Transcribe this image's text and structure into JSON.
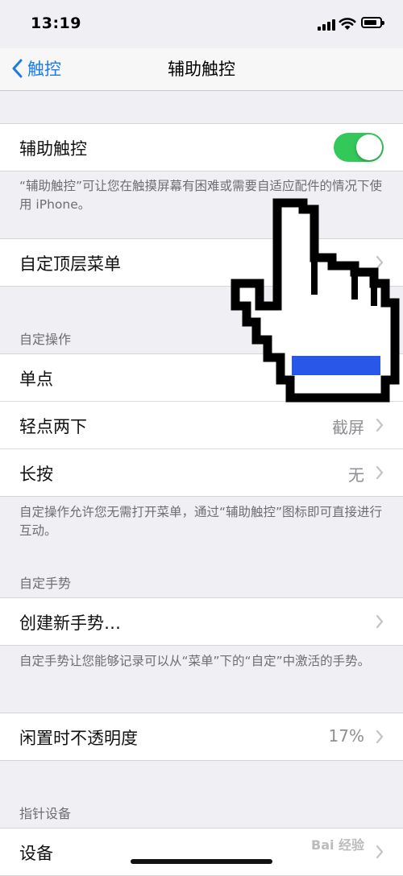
{
  "status_bar": {
    "time": "13:19"
  },
  "nav": {
    "back_label": "触控",
    "title": "辅助触控"
  },
  "toggle_row": {
    "label": "辅助触控",
    "on": true
  },
  "toggle_caption": "“辅助触控”可让您在触摸屏幕有困难或需要自适应配件的情况下使用 iPhone。",
  "top_menu": {
    "label": "自定顶层菜单"
  },
  "custom_actions": {
    "header": "自定操作",
    "rows": [
      {
        "label": "单点",
        "value": ""
      },
      {
        "label": "轻点两下",
        "value": "截屏"
      },
      {
        "label": "长按",
        "value": "无"
      }
    ],
    "caption": "自定操作允许您无需打开菜单，通过“辅助触控”图标即可直接进行互动。"
  },
  "custom_gestures": {
    "header": "自定手势",
    "row_label": "创建新手势…",
    "caption": "自定手势让您能够记录可以从“菜单”下的“自定”中激活的手势。"
  },
  "idle_opacity": {
    "label": "闲置时不透明度",
    "value": "17%"
  },
  "pointer_devices": {
    "header": "指针设备",
    "row_label": "设备"
  },
  "watermark": "Bai 经验",
  "colors": {
    "accent": "#1a7ce6",
    "toggle_on": "#34c759",
    "hand_highlight": "#2957e8"
  }
}
